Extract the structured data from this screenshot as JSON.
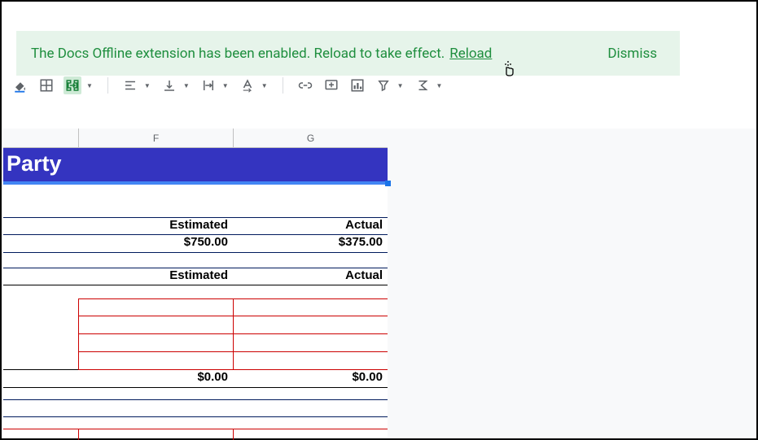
{
  "notification": {
    "message": "The Docs Offline extension has been enabled. Reload to take effect.",
    "reload_label": "Reload",
    "dismiss_label": "Dismiss"
  },
  "columns": {
    "f": "F",
    "g": "G"
  },
  "sheet": {
    "title": "Party",
    "header1": {
      "estimated": "Estimated",
      "actual": "Actual"
    },
    "values1": {
      "estimated": "$750.00",
      "actual": "$375.00"
    },
    "header2": {
      "estimated": "Estimated",
      "actual": "Actual"
    },
    "totals": {
      "estimated": "$0.00",
      "actual": "$0.00"
    }
  }
}
